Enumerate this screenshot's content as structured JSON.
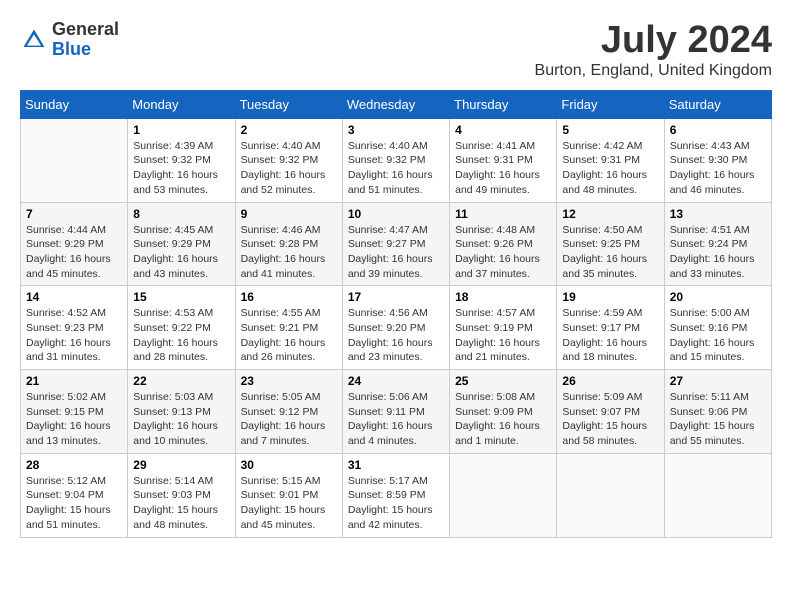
{
  "header": {
    "logo_general": "General",
    "logo_blue": "Blue",
    "month_year": "July 2024",
    "location": "Burton, England, United Kingdom"
  },
  "days_of_week": [
    "Sunday",
    "Monday",
    "Tuesday",
    "Wednesday",
    "Thursday",
    "Friday",
    "Saturday"
  ],
  "weeks": [
    [
      {
        "day": "",
        "sunrise": "",
        "sunset": "",
        "daylight": ""
      },
      {
        "day": "1",
        "sunrise": "Sunrise: 4:39 AM",
        "sunset": "Sunset: 9:32 PM",
        "daylight": "Daylight: 16 hours and 53 minutes."
      },
      {
        "day": "2",
        "sunrise": "Sunrise: 4:40 AM",
        "sunset": "Sunset: 9:32 PM",
        "daylight": "Daylight: 16 hours and 52 minutes."
      },
      {
        "day": "3",
        "sunrise": "Sunrise: 4:40 AM",
        "sunset": "Sunset: 9:32 PM",
        "daylight": "Daylight: 16 hours and 51 minutes."
      },
      {
        "day": "4",
        "sunrise": "Sunrise: 4:41 AM",
        "sunset": "Sunset: 9:31 PM",
        "daylight": "Daylight: 16 hours and 49 minutes."
      },
      {
        "day": "5",
        "sunrise": "Sunrise: 4:42 AM",
        "sunset": "Sunset: 9:31 PM",
        "daylight": "Daylight: 16 hours and 48 minutes."
      },
      {
        "day": "6",
        "sunrise": "Sunrise: 4:43 AM",
        "sunset": "Sunset: 9:30 PM",
        "daylight": "Daylight: 16 hours and 46 minutes."
      }
    ],
    [
      {
        "day": "7",
        "sunrise": "Sunrise: 4:44 AM",
        "sunset": "Sunset: 9:29 PM",
        "daylight": "Daylight: 16 hours and 45 minutes."
      },
      {
        "day": "8",
        "sunrise": "Sunrise: 4:45 AM",
        "sunset": "Sunset: 9:29 PM",
        "daylight": "Daylight: 16 hours and 43 minutes."
      },
      {
        "day": "9",
        "sunrise": "Sunrise: 4:46 AM",
        "sunset": "Sunset: 9:28 PM",
        "daylight": "Daylight: 16 hours and 41 minutes."
      },
      {
        "day": "10",
        "sunrise": "Sunrise: 4:47 AM",
        "sunset": "Sunset: 9:27 PM",
        "daylight": "Daylight: 16 hours and 39 minutes."
      },
      {
        "day": "11",
        "sunrise": "Sunrise: 4:48 AM",
        "sunset": "Sunset: 9:26 PM",
        "daylight": "Daylight: 16 hours and 37 minutes."
      },
      {
        "day": "12",
        "sunrise": "Sunrise: 4:50 AM",
        "sunset": "Sunset: 9:25 PM",
        "daylight": "Daylight: 16 hours and 35 minutes."
      },
      {
        "day": "13",
        "sunrise": "Sunrise: 4:51 AM",
        "sunset": "Sunset: 9:24 PM",
        "daylight": "Daylight: 16 hours and 33 minutes."
      }
    ],
    [
      {
        "day": "14",
        "sunrise": "Sunrise: 4:52 AM",
        "sunset": "Sunset: 9:23 PM",
        "daylight": "Daylight: 16 hours and 31 minutes."
      },
      {
        "day": "15",
        "sunrise": "Sunrise: 4:53 AM",
        "sunset": "Sunset: 9:22 PM",
        "daylight": "Daylight: 16 hours and 28 minutes."
      },
      {
        "day": "16",
        "sunrise": "Sunrise: 4:55 AM",
        "sunset": "Sunset: 9:21 PM",
        "daylight": "Daylight: 16 hours and 26 minutes."
      },
      {
        "day": "17",
        "sunrise": "Sunrise: 4:56 AM",
        "sunset": "Sunset: 9:20 PM",
        "daylight": "Daylight: 16 hours and 23 minutes."
      },
      {
        "day": "18",
        "sunrise": "Sunrise: 4:57 AM",
        "sunset": "Sunset: 9:19 PM",
        "daylight": "Daylight: 16 hours and 21 minutes."
      },
      {
        "day": "19",
        "sunrise": "Sunrise: 4:59 AM",
        "sunset": "Sunset: 9:17 PM",
        "daylight": "Daylight: 16 hours and 18 minutes."
      },
      {
        "day": "20",
        "sunrise": "Sunrise: 5:00 AM",
        "sunset": "Sunset: 9:16 PM",
        "daylight": "Daylight: 16 hours and 15 minutes."
      }
    ],
    [
      {
        "day": "21",
        "sunrise": "Sunrise: 5:02 AM",
        "sunset": "Sunset: 9:15 PM",
        "daylight": "Daylight: 16 hours and 13 minutes."
      },
      {
        "day": "22",
        "sunrise": "Sunrise: 5:03 AM",
        "sunset": "Sunset: 9:13 PM",
        "daylight": "Daylight: 16 hours and 10 minutes."
      },
      {
        "day": "23",
        "sunrise": "Sunrise: 5:05 AM",
        "sunset": "Sunset: 9:12 PM",
        "daylight": "Daylight: 16 hours and 7 minutes."
      },
      {
        "day": "24",
        "sunrise": "Sunrise: 5:06 AM",
        "sunset": "Sunset: 9:11 PM",
        "daylight": "Daylight: 16 hours and 4 minutes."
      },
      {
        "day": "25",
        "sunrise": "Sunrise: 5:08 AM",
        "sunset": "Sunset: 9:09 PM",
        "daylight": "Daylight: 16 hours and 1 minute."
      },
      {
        "day": "26",
        "sunrise": "Sunrise: 5:09 AM",
        "sunset": "Sunset: 9:07 PM",
        "daylight": "Daylight: 15 hours and 58 minutes."
      },
      {
        "day": "27",
        "sunrise": "Sunrise: 5:11 AM",
        "sunset": "Sunset: 9:06 PM",
        "daylight": "Daylight: 15 hours and 55 minutes."
      }
    ],
    [
      {
        "day": "28",
        "sunrise": "Sunrise: 5:12 AM",
        "sunset": "Sunset: 9:04 PM",
        "daylight": "Daylight: 15 hours and 51 minutes."
      },
      {
        "day": "29",
        "sunrise": "Sunrise: 5:14 AM",
        "sunset": "Sunset: 9:03 PM",
        "daylight": "Daylight: 15 hours and 48 minutes."
      },
      {
        "day": "30",
        "sunrise": "Sunrise: 5:15 AM",
        "sunset": "Sunset: 9:01 PM",
        "daylight": "Daylight: 15 hours and 45 minutes."
      },
      {
        "day": "31",
        "sunrise": "Sunrise: 5:17 AM",
        "sunset": "Sunset: 8:59 PM",
        "daylight": "Daylight: 15 hours and 42 minutes."
      },
      {
        "day": "",
        "sunrise": "",
        "sunset": "",
        "daylight": ""
      },
      {
        "day": "",
        "sunrise": "",
        "sunset": "",
        "daylight": ""
      },
      {
        "day": "",
        "sunrise": "",
        "sunset": "",
        "daylight": ""
      }
    ]
  ]
}
